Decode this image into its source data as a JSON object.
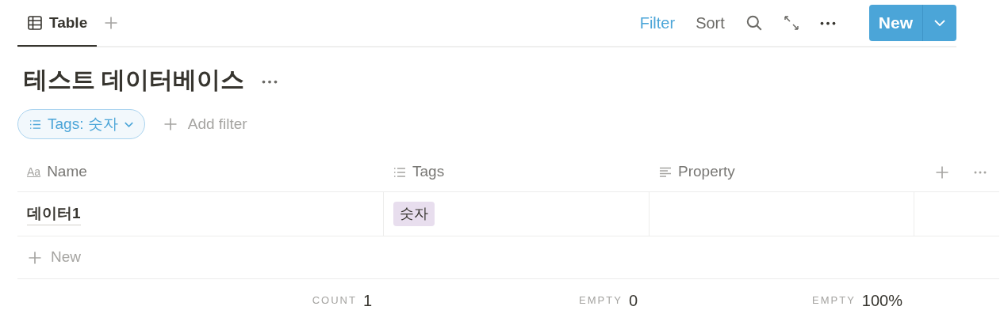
{
  "views": [
    {
      "label": "Table",
      "selected": true
    }
  ],
  "toolbar": [
    {
      "label": "Filter",
      "active": true
    },
    {
      "label": "Sort",
      "active": false
    }
  ],
  "new_button": {
    "label": "New"
  },
  "title": "테스트 데이터베이스",
  "filters": [
    {
      "label": "Tags: 숫자"
    }
  ],
  "add_filter": "Add filter",
  "table": {
    "columns": [
      {
        "name": "Name",
        "kind": "title",
        "icon_text": "Aa"
      },
      {
        "name": "Tags",
        "kind": "tags"
      },
      {
        "name": "Property",
        "kind": "text"
      }
    ],
    "rows": [
      {
        "name": "데이터1",
        "tags": [
          {
            "label": "숫자",
            "color": "#e8deee"
          }
        ],
        "property": ""
      }
    ],
    "new_row": "New",
    "footer": [
      {
        "label": "COUNT",
        "value": "1"
      },
      {
        "label": "EMPTY",
        "value": "0"
      },
      {
        "label": "EMPTY",
        "value": "100%"
      }
    ]
  }
}
